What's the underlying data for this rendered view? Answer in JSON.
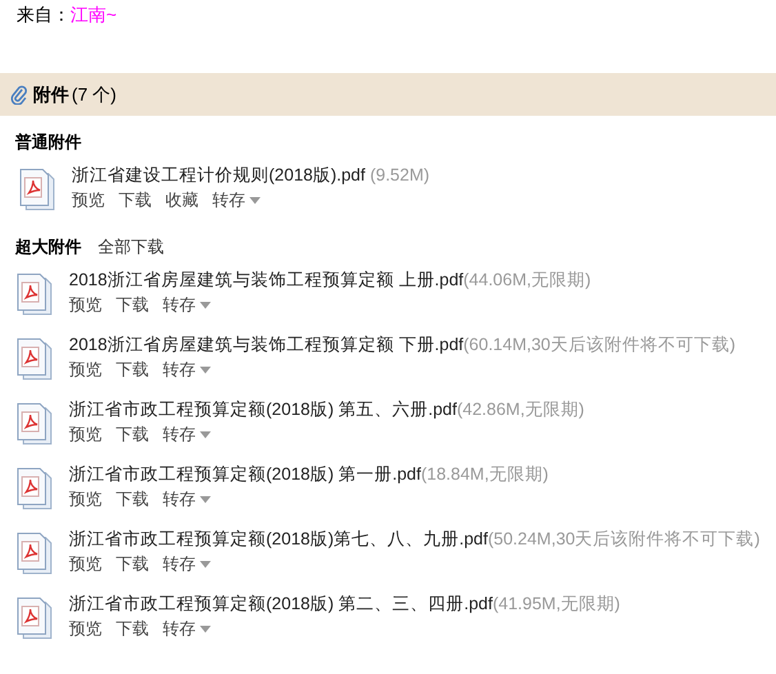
{
  "sender": {
    "label": "来自：",
    "name": "江南~"
  },
  "attachments_header": {
    "title": "附件",
    "count": "(7 个)"
  },
  "sections": [
    {
      "title": "普通附件",
      "files": [
        {
          "name": "浙江省建设工程计价规则(2018版).pdf",
          "meta": " (9.52M)",
          "actions": [
            {
              "label": "预览",
              "kind": "link"
            },
            {
              "label": "下载",
              "kind": "link"
            },
            {
              "label": "收藏",
              "kind": "link"
            },
            {
              "label": "转存",
              "kind": "dropdown"
            }
          ]
        }
      ]
    },
    {
      "title": "超大附件",
      "link": "全部下载",
      "files": [
        {
          "name": "2018浙江省房屋建筑与装饰工程预算定额 上册.pdf",
          "meta": "(44.06M,无限期)",
          "actions": [
            {
              "label": "预览",
              "kind": "link"
            },
            {
              "label": "下载",
              "kind": "link"
            },
            {
              "label": "转存",
              "kind": "dropdown"
            }
          ]
        },
        {
          "name": "2018浙江省房屋建筑与装饰工程预算定额 下册.pdf",
          "meta": "(60.14M,30天后该附件将不可下载)",
          "actions": [
            {
              "label": "预览",
              "kind": "link"
            },
            {
              "label": "下载",
              "kind": "link"
            },
            {
              "label": "转存",
              "kind": "dropdown"
            }
          ]
        },
        {
          "name": "浙江省市政工程预算定额(2018版) 第五、六册.pdf",
          "meta": "(42.86M,无限期)",
          "actions": [
            {
              "label": "预览",
              "kind": "link"
            },
            {
              "label": "下载",
              "kind": "link"
            },
            {
              "label": "转存",
              "kind": "dropdown"
            }
          ]
        },
        {
          "name": "浙江省市政工程预算定额(2018版) 第一册.pdf",
          "meta": "(18.84M,无限期)",
          "actions": [
            {
              "label": "预览",
              "kind": "link"
            },
            {
              "label": "下载",
              "kind": "link"
            },
            {
              "label": "转存",
              "kind": "dropdown"
            }
          ]
        },
        {
          "name": "浙江省市政工程预算定额(2018版)第七、八、九册.pdf",
          "meta": "(50.24M,30天后该附件将不可下载)",
          "actions": [
            {
              "label": "预览",
              "kind": "link"
            },
            {
              "label": "下载",
              "kind": "link"
            },
            {
              "label": "转存",
              "kind": "dropdown"
            }
          ]
        },
        {
          "name": "浙江省市政工程预算定额(2018版) 第二、三、四册.pdf",
          "meta": "(41.95M,无限期)",
          "actions": [
            {
              "label": "预览",
              "kind": "link"
            },
            {
              "label": "下载",
              "kind": "link"
            },
            {
              "label": "转存",
              "kind": "dropdown"
            }
          ]
        }
      ]
    }
  ]
}
